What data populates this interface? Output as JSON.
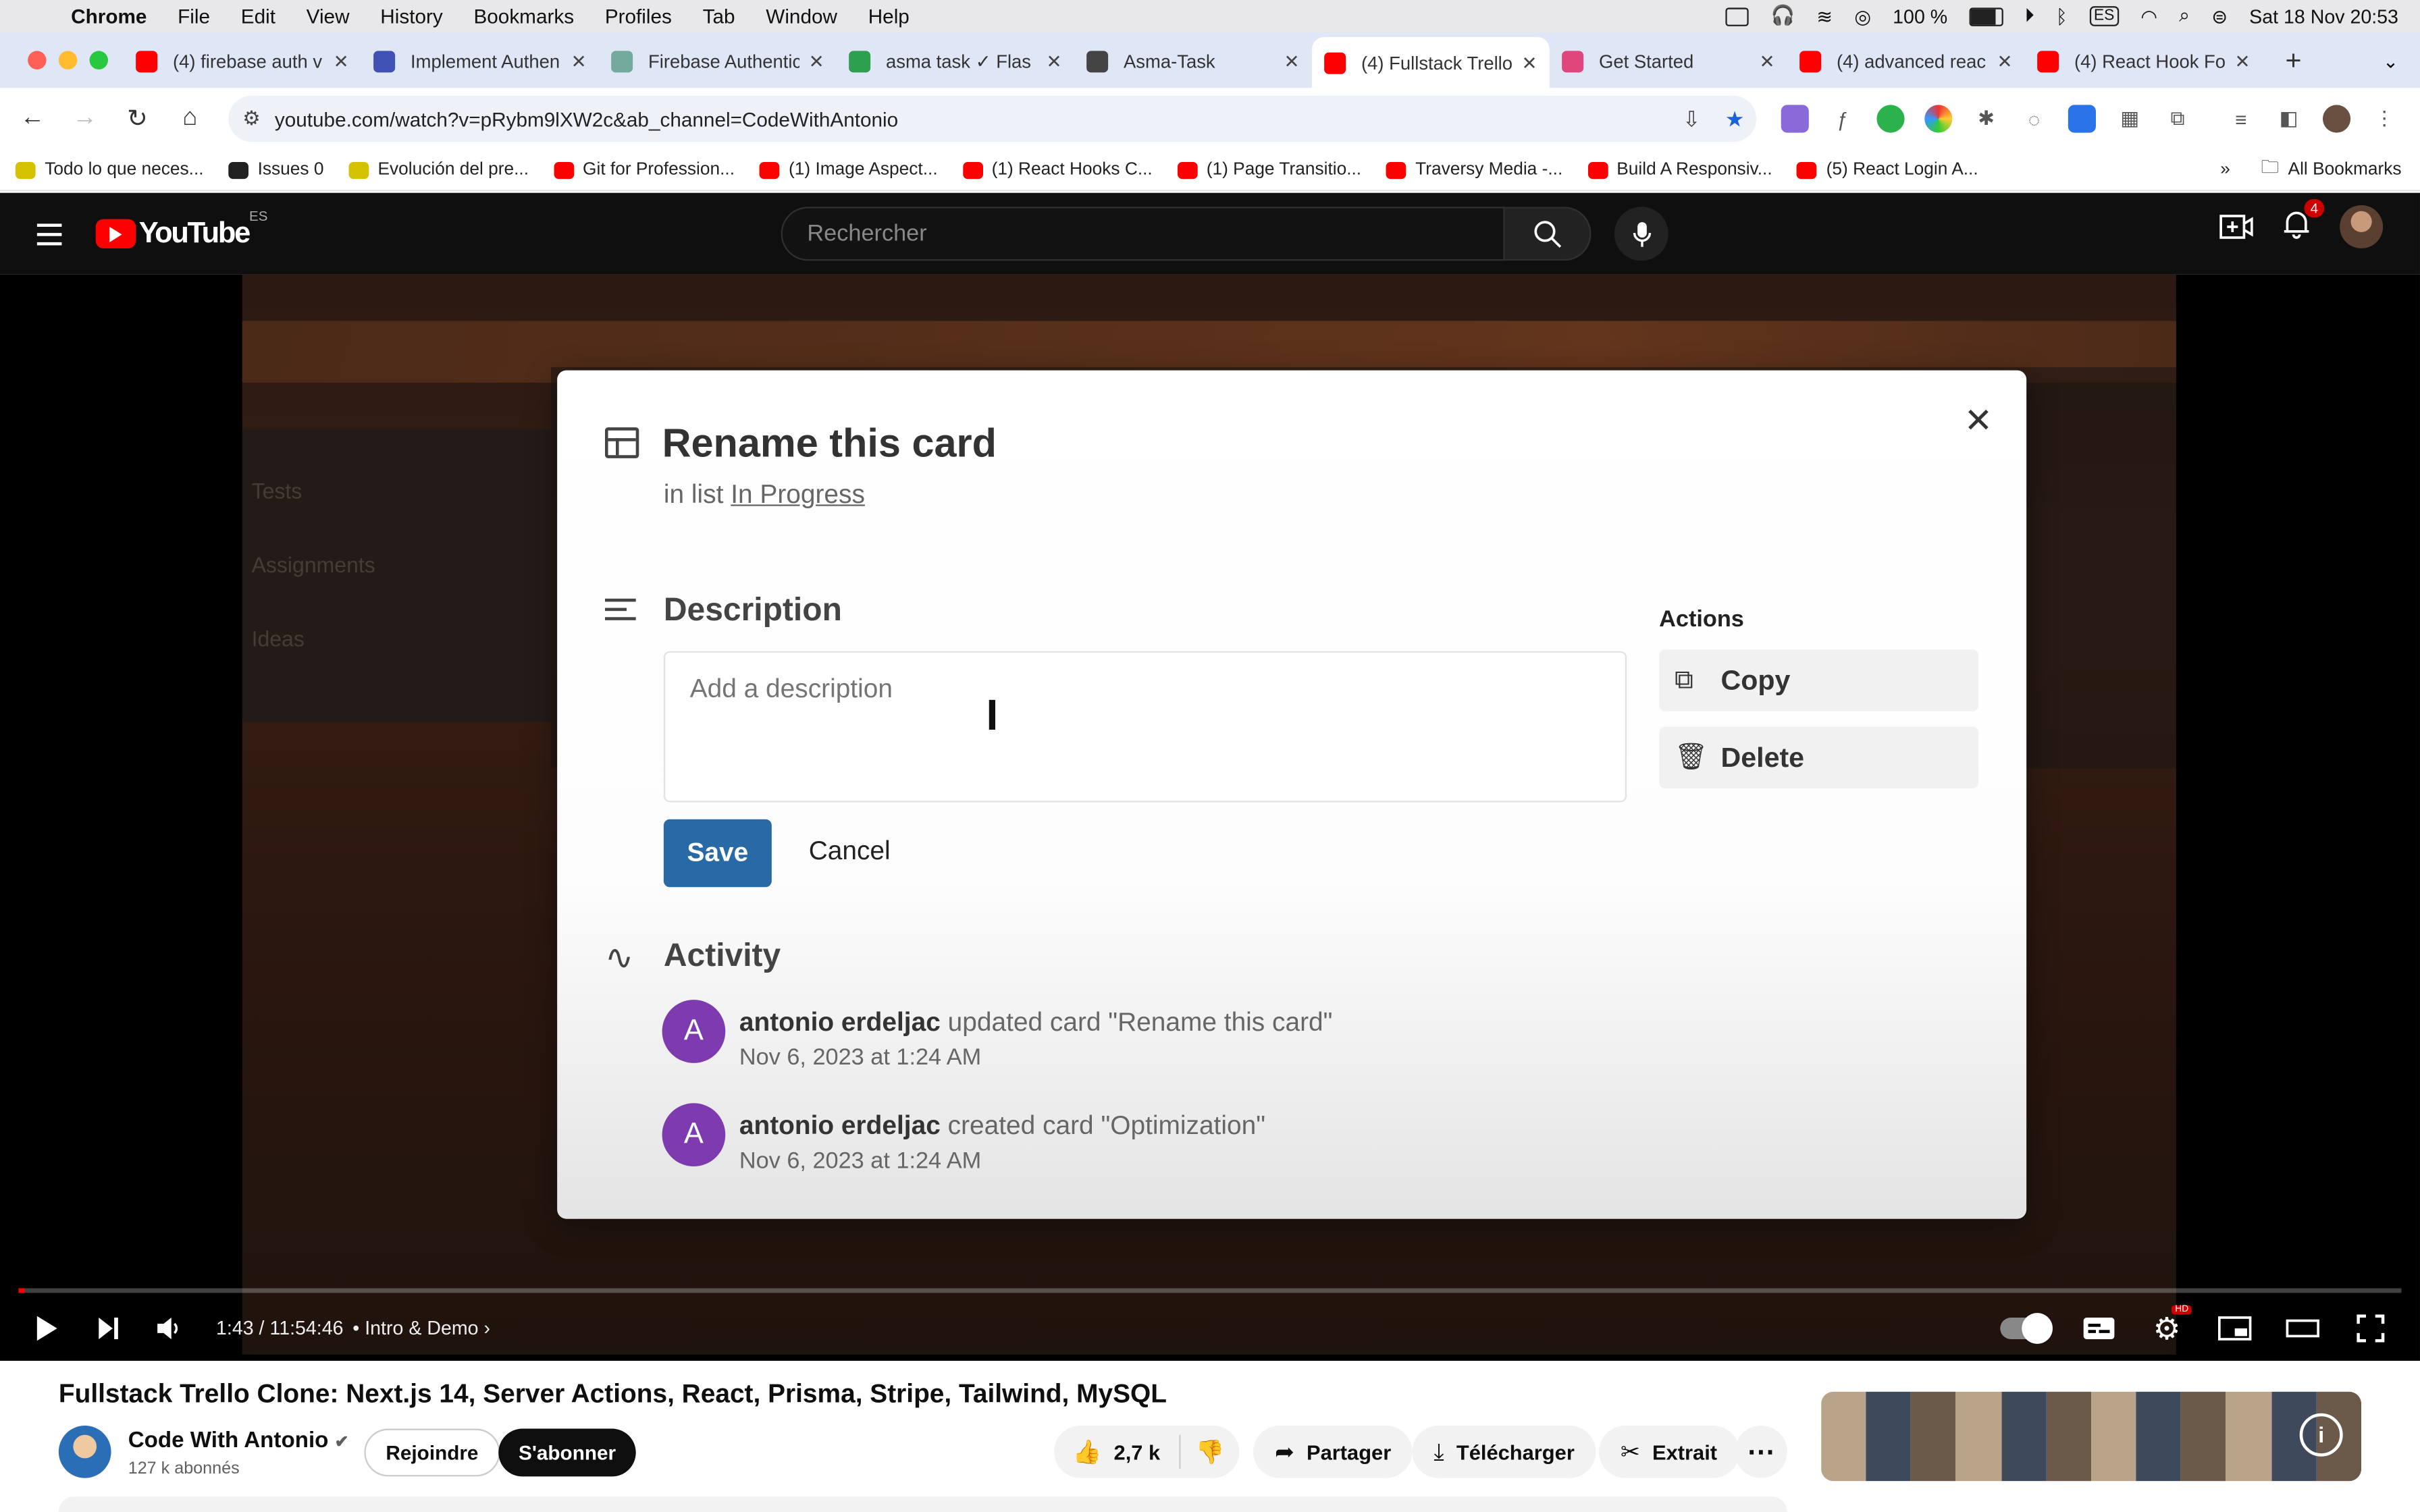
{
  "menubar": {
    "app": "Chrome",
    "items": [
      "File",
      "Edit",
      "View",
      "History",
      "Bookmarks",
      "Profiles",
      "Tab",
      "Window",
      "Help"
    ],
    "battery": "100 %",
    "input_source": "ES",
    "datetime": "Sat 18 Nov  20:53"
  },
  "tabs": [
    {
      "title": "(4) firebase auth v",
      "favicon_color": "#ff0000"
    },
    {
      "title": "Implement Authen",
      "favicon_color": "#3f51b5"
    },
    {
      "title": "Firebase Authentic",
      "favicon_color": "#74aa9c"
    },
    {
      "title": "asma task ✓ Flas",
      "favicon_color": "#2e9e4f"
    },
    {
      "title": "Asma-Task",
      "favicon_color": "#444444"
    },
    {
      "title": "(4) Fullstack Trello",
      "favicon_color": "#ff0000",
      "active": true
    },
    {
      "title": "Get Started",
      "favicon_color": "#e0457b"
    },
    {
      "title": "(4) advanced reac",
      "favicon_color": "#ff0000"
    },
    {
      "title": "(4) React Hook Fo",
      "favicon_color": "#ff0000"
    }
  ],
  "toolbar": {
    "url": "youtube.com/watch?v=pRybm9lXW2c&ab_channel=CodeWithAntonio"
  },
  "bookmarks": [
    {
      "label": "Todo lo que neces...",
      "color": "#d4c200"
    },
    {
      "label": "Issues 0",
      "color": "#222222"
    },
    {
      "label": "Evolución del pre...",
      "color": "#d4c200"
    },
    {
      "label": "Git for Profession...",
      "color": "#ff0000"
    },
    {
      "label": "(1) Image Aspect...",
      "color": "#ff0000"
    },
    {
      "label": "(1) React Hooks C...",
      "color": "#ff0000"
    },
    {
      "label": "(1) Page Transitio...",
      "color": "#ff0000"
    },
    {
      "label": "Traversy Media -...",
      "color": "#ff0000"
    },
    {
      "label": "Build A Responsiv...",
      "color": "#ff0000"
    },
    {
      "label": "(5) React Login A...",
      "color": "#ff0000"
    }
  ],
  "bookmarks_all": "All Bookmarks",
  "youtube": {
    "logo": "YouTube",
    "country": "ES",
    "search_placeholder": "Rechercher",
    "notifications": "4"
  },
  "video_frame": {
    "modal": {
      "title": "Rename this card",
      "in_list_prefix": "in list",
      "list_name": "In Progress",
      "description_heading": "Description",
      "description_placeholder": "Add a description",
      "save": "Save",
      "cancel": "Cancel",
      "actions_heading": "Actions",
      "copy": "Copy",
      "delete": "Delete",
      "activity_heading": "Activity",
      "activity": [
        {
          "initial": "A",
          "user": "antonio erdeljac",
          "action": "updated card \"Rename this card\"",
          "date": "Nov 6, 2023 at 1:24 AM"
        },
        {
          "initial": "A",
          "user": "antonio erdeljac",
          "action": "created card \"Optimization\"",
          "date": "Nov 6, 2023 at 1:24 AM"
        }
      ]
    }
  },
  "player": {
    "time": "1:43 / 11:54:46",
    "chapter": "Intro & Demo",
    "progress_fraction": 0.0024
  },
  "video_info": {
    "title": "Fullstack Trello Clone: Next.js 14, Server Actions, React, Prisma, Stripe, Tailwind, MySQL",
    "channel": "Code With Antonio",
    "subscribers": "127 k abonnés",
    "join": "Rejoindre",
    "subscribe": "S'abonner",
    "likes": "2,7 k",
    "share": "Partager",
    "download": "Télécharger",
    "clip": "Extrait"
  }
}
